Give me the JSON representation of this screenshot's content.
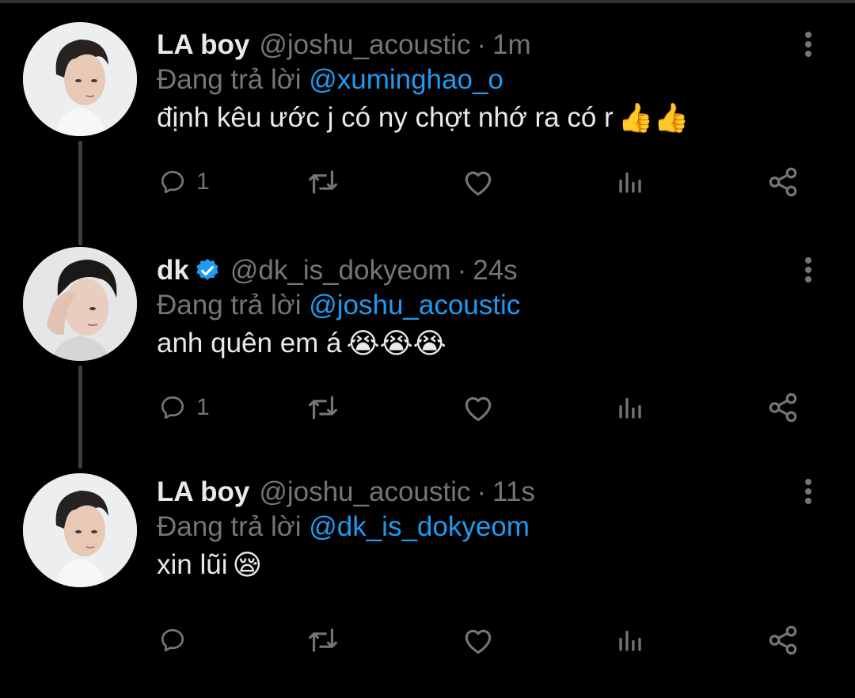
{
  "tweets": [
    {
      "name": "LA boy",
      "handle": "@joshu_acoustic",
      "separator": "·",
      "time": "1m",
      "reply_prefix": "Đang trả lời ",
      "reply_to": "@xuminghao_o",
      "text": "định kêu ước j có ny chợt nhớ ra có r",
      "emoji": "👍👍",
      "reply_count": "1",
      "verified": false,
      "avatar": "avatar-joshua"
    },
    {
      "name": "dk",
      "handle": "@dk_is_dokyeom",
      "separator": "·",
      "time": "24s",
      "reply_prefix": "Đang trả lời ",
      "reply_to": "@joshu_acoustic",
      "text": "anh quên em á",
      "emoji": "😭😭😭",
      "reply_count": "1",
      "verified": true,
      "avatar": "avatar-dokyeom"
    },
    {
      "name": "LA boy",
      "handle": "@joshu_acoustic",
      "separator": "·",
      "time": "11s",
      "reply_prefix": "Đang trả lời ",
      "reply_to": "@dk_is_dokyeom",
      "text": "xin lũi",
      "emoji": "😪",
      "reply_count": "",
      "verified": false,
      "avatar": "avatar-joshua"
    }
  ],
  "icons": {
    "reply": "reply-icon",
    "retweet": "retweet-icon",
    "like": "like-icon",
    "analytics": "analytics-icon",
    "share": "share-icon",
    "more": "more-vertical-icon",
    "verified": "verified-badge-icon"
  },
  "colors": {
    "background": "#000000",
    "text": "#e7e9ea",
    "secondary": "#71767b",
    "mention": "#1d9bf0",
    "thread_line": "#3c3f42"
  }
}
